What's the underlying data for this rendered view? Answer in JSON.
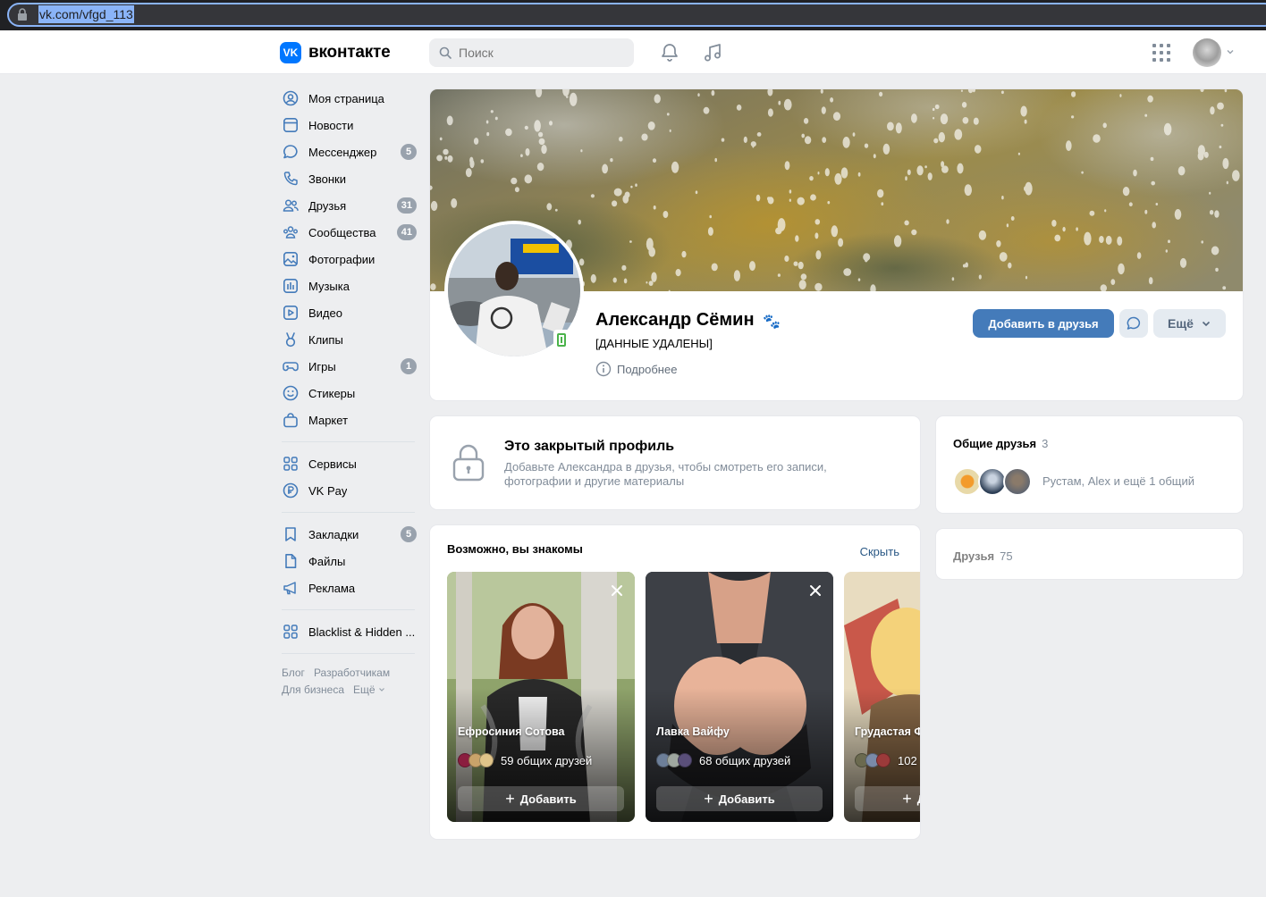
{
  "browser": {
    "url": "vk.com/vfgd_113"
  },
  "header": {
    "logo_text": "вконтакте",
    "search_placeholder": "Поиск"
  },
  "nav": {
    "items": [
      {
        "label": "Моя страница",
        "icon": "user-circle-icon"
      },
      {
        "label": "Новости",
        "icon": "news-icon"
      },
      {
        "label": "Мессенджер",
        "icon": "message-icon",
        "count": "5"
      },
      {
        "label": "Звонки",
        "icon": "phone-icon"
      },
      {
        "label": "Друзья",
        "icon": "friends-icon",
        "count": "31"
      },
      {
        "label": "Сообщества",
        "icon": "communities-icon",
        "count": "41"
      },
      {
        "label": "Фотографии",
        "icon": "photo-icon"
      },
      {
        "label": "Музыка",
        "icon": "music-icon"
      },
      {
        "label": "Видео",
        "icon": "video-icon"
      },
      {
        "label": "Клипы",
        "icon": "clips-icon"
      },
      {
        "label": "Игры",
        "icon": "gamepad-icon",
        "count": "1"
      },
      {
        "label": "Стикеры",
        "icon": "smile-icon"
      },
      {
        "label": "Маркет",
        "icon": "bag-icon"
      }
    ],
    "group2": [
      {
        "label": "Сервисы",
        "icon": "services-icon"
      },
      {
        "label": "VK Pay",
        "icon": "ruble-icon"
      }
    ],
    "group3": [
      {
        "label": "Закладки",
        "icon": "bookmark-icon",
        "count": "5"
      },
      {
        "label": "Файлы",
        "icon": "file-icon"
      },
      {
        "label": "Реклама",
        "icon": "megaphone-icon"
      }
    ],
    "group4": [
      {
        "label": "Blacklist & Hidden ...",
        "icon": "services-icon"
      }
    ],
    "footer": {
      "blog": "Блог",
      "dev": "Разработчикам",
      "business": "Для бизнеса",
      "more": "Ещё"
    }
  },
  "profile": {
    "name": "Александр Сёмин",
    "name_emoji": "🐾",
    "status": "[ДАННЫЕ УДАЛЕНЫ]",
    "more_info": "Подробнее",
    "add_friend": "Добавить в друзья",
    "more_button": "Ещё"
  },
  "closed_profile": {
    "title": "Это закрытый профиль",
    "text": "Добавьте Александра в друзья, чтобы смотреть его записи, фотографии и другие материалы"
  },
  "maybe_known": {
    "title": "Возможно, вы знакомы",
    "hide": "Скрыть",
    "add_label": "Добавить",
    "suggestions": [
      {
        "name": "Ефросиния Сотова",
        "mutual": "59 общих друзей"
      },
      {
        "name": "Лавка Вайфу",
        "mutual": "68 общих друзей"
      },
      {
        "name": "Грудастая Ф",
        "mutual": "102"
      }
    ]
  },
  "mutual_friends": {
    "title": "Общие друзья",
    "count": "3",
    "text": "Рустам, Alex и ещё 1 общий"
  },
  "friends": {
    "title": "Друзья",
    "count": "75"
  },
  "colors": {
    "accent": "#447bba",
    "background": "#edeef0",
    "badge": "#99a2ad",
    "online": "#4bb34b"
  }
}
